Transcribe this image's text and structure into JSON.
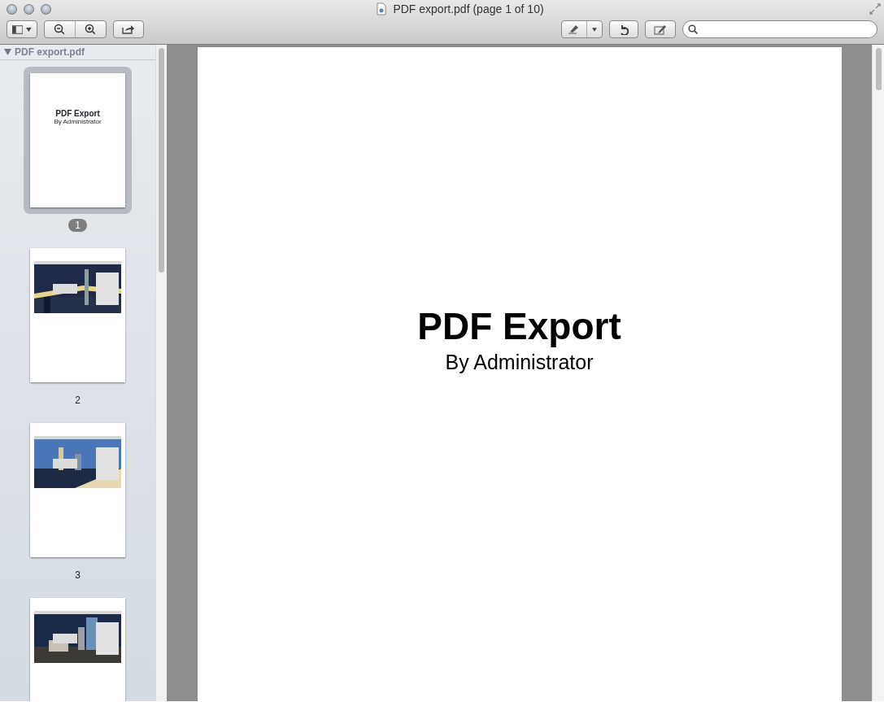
{
  "window": {
    "title": "PDF export.pdf (page 1 of 10)"
  },
  "sidebar": {
    "document": "PDF export.pdf",
    "expanded": true,
    "pages": [
      {
        "kind": "title",
        "label": "1",
        "selected": true,
        "title": "PDF Export",
        "subtitle": "By Administrator"
      },
      {
        "kind": "screenshot",
        "label": "2",
        "selected": false
      },
      {
        "kind": "screenshot",
        "label": "3",
        "selected": false
      },
      {
        "kind": "screenshot",
        "selected": false
      }
    ]
  },
  "page": {
    "title": "PDF Export",
    "subtitle": "By Administrator"
  }
}
